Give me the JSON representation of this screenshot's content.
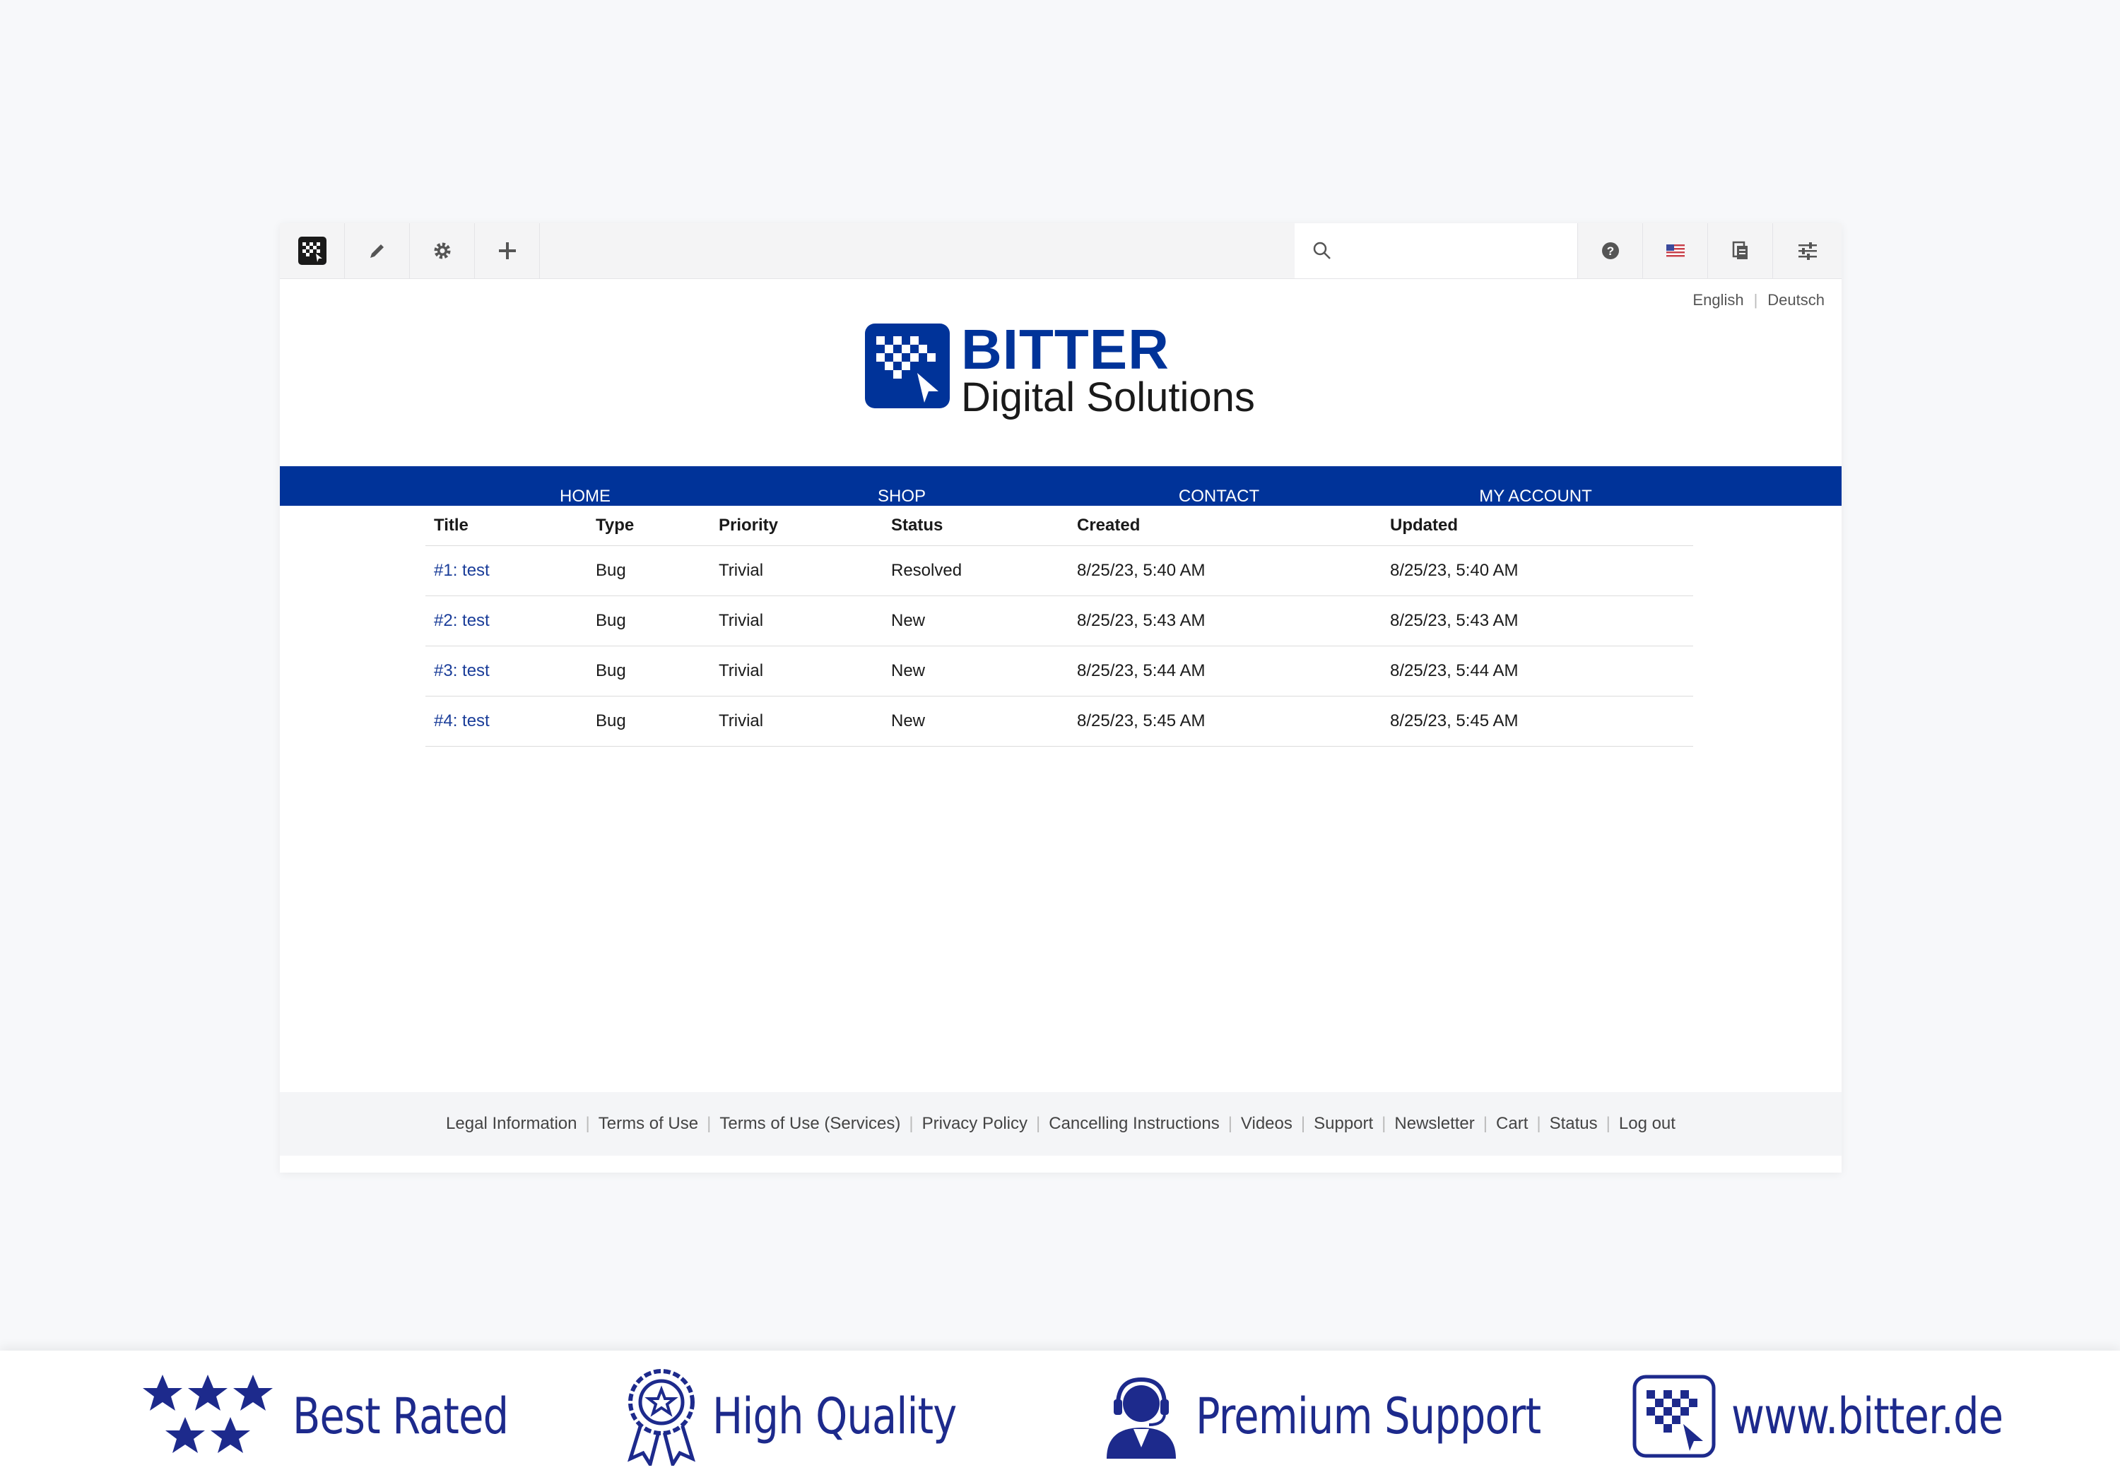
{
  "toolbar": {
    "left_icons": [
      "app-logo-icon",
      "pencil-icon",
      "gear-icon",
      "plus-icon"
    ],
    "search_placeholder": "",
    "right_icons": [
      "help-icon",
      "us-flag-icon",
      "document-icon",
      "sliders-icon"
    ]
  },
  "languages": {
    "english": "English",
    "deutsch": "Deutsch"
  },
  "logo": {
    "title": "BITTER",
    "subtitle": "Digital Solutions"
  },
  "nav": {
    "items": [
      {
        "label": "HOME"
      },
      {
        "label": "SHOP"
      },
      {
        "label": "CONTACT"
      },
      {
        "label": "MY ACCOUNT"
      }
    ]
  },
  "table": {
    "headers": [
      "Title",
      "Type",
      "Priority",
      "Status",
      "Created",
      "Updated"
    ],
    "rows": [
      {
        "title": "#1: test",
        "type": "Bug",
        "priority": "Trivial",
        "status": "Resolved",
        "created": "8/25/23, 5:40 AM",
        "updated": "8/25/23, 5:40 AM"
      },
      {
        "title": "#2: test",
        "type": "Bug",
        "priority": "Trivial",
        "status": "New",
        "created": "8/25/23, 5:43 AM",
        "updated": "8/25/23, 5:43 AM"
      },
      {
        "title": "#3: test",
        "type": "Bug",
        "priority": "Trivial",
        "status": "New",
        "created": "8/25/23, 5:44 AM",
        "updated": "8/25/23, 5:44 AM"
      },
      {
        "title": "#4: test",
        "type": "Bug",
        "priority": "Trivial",
        "status": "New",
        "created": "8/25/23, 5:45 AM",
        "updated": "8/25/23, 5:45 AM"
      }
    ]
  },
  "footer": {
    "links": [
      "Legal Information",
      "Terms of Use",
      "Terms of Use (Services)",
      "Privacy Policy",
      "Cancelling Instructions",
      "Videos",
      "Support",
      "Newsletter",
      "Cart",
      "Status",
      "Log out"
    ]
  },
  "banner": {
    "items": [
      {
        "label": "Best Rated",
        "icon": "stars-icon"
      },
      {
        "label": "High Quality",
        "icon": "award-ribbon-icon"
      },
      {
        "label": "Premium Support",
        "icon": "support-agent-icon"
      },
      {
        "label": "www.bitter.de",
        "icon": "bitter-logo-icon"
      }
    ]
  },
  "colors": {
    "brand_blue": "#003399",
    "link_blue": "#1a3d99",
    "banner_blue": "#1d2a8c"
  }
}
